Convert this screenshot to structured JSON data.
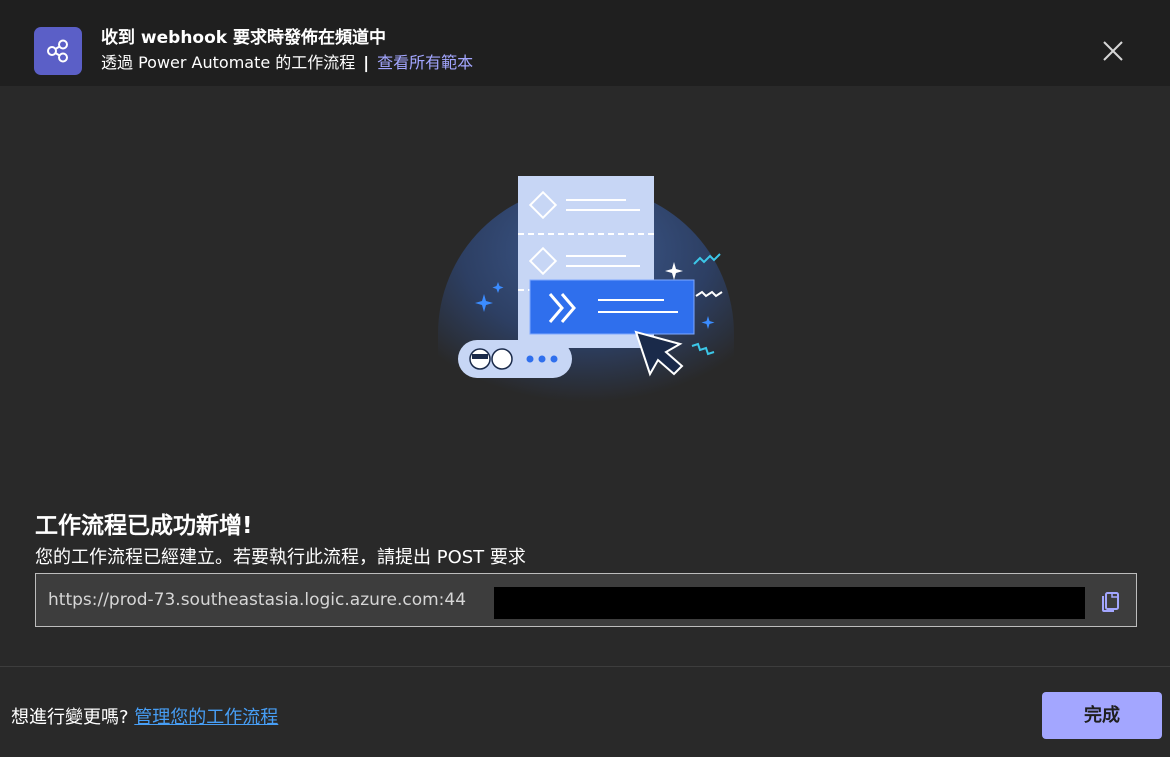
{
  "header": {
    "title": "收到 webhook 要求時發佈在頻道中",
    "subtitle_prefix": "透過 Power Automate 的工作流程",
    "separator": "|",
    "templates_link": "查看所有範本",
    "app_icon": "share-nodes-icon",
    "close_icon": "close-icon"
  },
  "content": {
    "success_title": "工作流程已成功新增!",
    "success_description": "您的工作流程已經建立。若要執行此流程，請提出 POST 要求",
    "url_value": "https://prod-73.southeastasia.logic.azure.com:44",
    "copy_icon": "copy-icon"
  },
  "footer": {
    "question": "想進行變更嗎?",
    "manage_link": "管理您的工作流程",
    "done_label": "完成"
  },
  "colors": {
    "accent": "#5b5fc7",
    "link": "#a3a6ff",
    "footer_link": "#479ef5",
    "button_bg": "#a3a6ff"
  }
}
